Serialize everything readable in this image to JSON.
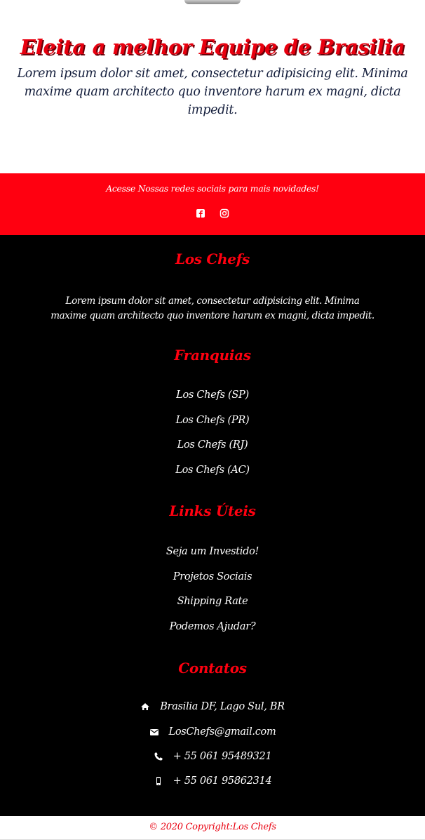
{
  "hero": {
    "title": "Eleita a melhor Equipe de Brasilia",
    "text": "Lorem ipsum dolor sit amet, consectetur adipisicing elit. Minima maxime quam architecto quo inventore harum ex magni, dicta impedit."
  },
  "social": {
    "text": "Acesse Nossas redes sociais para mais novidades!",
    "icons": [
      "facebook-icon",
      "instagram-icon"
    ]
  },
  "footer": {
    "about": {
      "heading": "Los Chefs",
      "text": "Lorem ipsum dolor sit amet, consectetur adipisicing elit. Minima maxime quam architecto quo inventore harum ex magni, dicta impedit."
    },
    "franquias": {
      "heading": "Franquias",
      "items": [
        "Los Chefs (SP)",
        "Los Chefs (PR)",
        "Los Chefs (RJ)",
        "Los Chefs (AC)"
      ]
    },
    "links": {
      "heading": "Links Úteis",
      "items": [
        "Seja um Investido!",
        "Projetos Sociais",
        "Shipping Rate",
        "Podemos Ajudar?"
      ]
    },
    "contatos": {
      "heading": "Contatos",
      "items": [
        {
          "icon": "home-icon",
          "text": "Brasilia DF, Lago Sul, BR"
        },
        {
          "icon": "envelope-icon",
          "text": "LosChefs@gmail.com"
        },
        {
          "icon": "phone-icon",
          "text": "+ 55 061 95489321"
        },
        {
          "icon": "mobile-icon",
          "text": "+ 55 061 95862314"
        }
      ]
    }
  },
  "copyright": "© 2020 Copyright:Los Chefs",
  "colors": {
    "accent": "#ff0010",
    "footer_bg": "#000000",
    "hero_text": "#141e3c"
  }
}
